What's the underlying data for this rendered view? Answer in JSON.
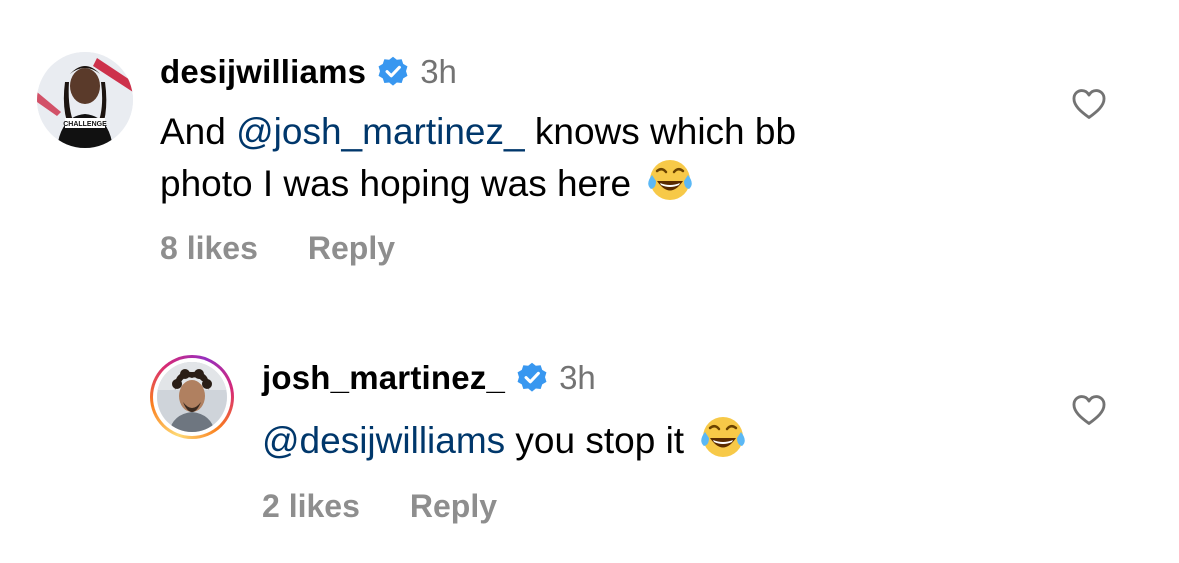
{
  "comments": [
    {
      "username": "desijwilliams",
      "time": "3h",
      "text_prefix": "And ",
      "mention": "@josh_martinez_",
      "text_rest_line1": " knows which bb",
      "text_line2": "photo I was hoping was here",
      "emoji": "face-with-tears-of-joy",
      "likes": "8 likes",
      "reply": "Reply",
      "avatar_badge_text": "CHALLENGE"
    },
    {
      "username": "josh_martinez_",
      "time": "3h",
      "mention": "@desijwilliams",
      "text_rest": " you stop it",
      "emoji": "face-with-tears-of-joy",
      "likes": "2 likes",
      "reply": "Reply"
    }
  ],
  "colors": {
    "mention": "#00376b",
    "secondary": "#737373",
    "meta": "#8e8e8e",
    "verified": "#3897f0"
  },
  "icons": {
    "verified": "verified-badge-icon",
    "like": "heart-outline-icon",
    "emoji": "laughing-tears-emoji-icon"
  }
}
